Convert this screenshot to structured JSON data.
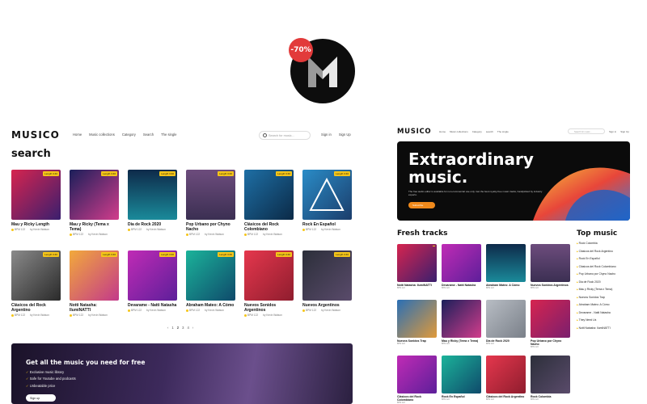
{
  "badge": {
    "discount": "-70%",
    "logo": "M"
  },
  "left": {
    "brand": "MUSICO",
    "nav": [
      "Home",
      "Music collections",
      "Category",
      "Search",
      "The single"
    ],
    "search_placeholder": "Search for music...",
    "auth": [
      "Sign in",
      "Sign Up"
    ],
    "page_title": "search",
    "cards": [
      {
        "title": "Mau y Ricky Length",
        "meta": "BPM 122",
        "by": "by Kevin Watson",
        "tag": "Length 3:40"
      },
      {
        "title": "Mau y Ricky (Tema x Tema)",
        "meta": "BPM 122",
        "by": "by Kevin Watson",
        "tag": "Length 3:40"
      },
      {
        "title": "Dia de Rock 2020",
        "meta": "BPM 122",
        "by": "by Kevin Watson",
        "tag": "Length 3:40"
      },
      {
        "title": "Pop Urbano por Chyno Nacho",
        "meta": "BPM 122",
        "by": "by Kevin Watson",
        "tag": "Length 3:40"
      },
      {
        "title": "Clásicos del Rock Colombiano",
        "meta": "BPM 122",
        "by": "by Kevin Watson",
        "tag": "Length 3:40"
      },
      {
        "title": "Rock En Español",
        "meta": "BPM 122",
        "by": "by Kevin Watson",
        "tag": "Length 3:40"
      },
      {
        "title": "Clásicos del Rock Argentino",
        "meta": "BPM 122",
        "by": "by Kevin Watson",
        "tag": "Length 3:40"
      },
      {
        "title": "Notti Natasha: IlumiNATTI",
        "meta": "BPM 122",
        "by": "by Kevin Watson",
        "tag": "Length 3:40"
      },
      {
        "title": "Devarame - Natti Natasha",
        "meta": "BPM 122",
        "by": "by Kevin Watson",
        "tag": "Length 3:40"
      },
      {
        "title": "Abraham Mateo: A Cómo",
        "meta": "BPM 122",
        "by": "by Kevin Watson",
        "tag": "Length 3:40"
      },
      {
        "title": "Nuevos Sonidos Argentinos",
        "meta": "BPM 122",
        "by": "by Kevin Watson",
        "tag": "Length 3:40"
      },
      {
        "title": "Nuevos Argentinos",
        "meta": "BPM 122",
        "by": "by Kevin Watson",
        "tag": "Length 3:40"
      }
    ],
    "pager": [
      "‹",
      "1",
      "2",
      "3",
      "4",
      "›"
    ],
    "banner": {
      "headline": "Get all the music you need for free",
      "features": [
        "Exclusive music library",
        "Safe for Youtube and podcasts",
        "Unbeatable price"
      ],
      "button": "Sign up"
    }
  },
  "right": {
    "brand": "MUSICO",
    "nav": [
      "Home",
      "Music collections",
      "Category",
      "search",
      "The single"
    ],
    "search_placeholder": "Search for music...",
    "auth": [
      "Sign in",
      "Sign Up"
    ],
    "hero_title_1": "Extraordinary",
    "hero_title_2": "music.",
    "hero_sub": "The free audio editor is available for non-commercial use only. Get the best royalty-free music tracks, handpicked by industry experts.",
    "hero_button": "Subscribe",
    "fresh_title": "Fresh tracks",
    "top_title": "Top music",
    "fresh": [
      {
        "title": "Notti Natasha: IlumiNATTI",
        "meta": "BPM 122"
      },
      {
        "title": "Devarame - Natti Natasha",
        "meta": "BPM 122"
      },
      {
        "title": "Abraham Mateo: A Cómo",
        "meta": "BPM 122"
      },
      {
        "title": "Nuevos Sonidos Argentinos",
        "meta": "BPM 122"
      },
      {
        "title": "Nuevos Sonidos Trap",
        "meta": "BPM 122"
      },
      {
        "title": "Mau y Ricky (Tema x Tema)",
        "meta": "BPM 122"
      },
      {
        "title": "Dia de Rock 2020",
        "meta": "BPM 122"
      },
      {
        "title": "Pop Urbano por Chyno Nacho",
        "meta": "BPM 122"
      },
      {
        "title": "Clásicos del Rock Colombiano",
        "meta": "BPM 122"
      },
      {
        "title": "Rock En Español",
        "meta": "BPM 122"
      },
      {
        "title": "Clásicos del Rock Argentino",
        "meta": "BPM 122"
      },
      {
        "title": "Rock Colombia",
        "meta": "BPM 122"
      }
    ],
    "top": [
      "Rock Colombia",
      "Clásicos del Rock Argentino",
      "Rock En Español",
      "Clásicos del Rock Colombiano",
      "Pop Urbano por Chyno Nacho",
      "Dia de Rock 2020",
      "Mau y Ricky (Tema x Tema)",
      "Nuevos Sonidos Trap",
      "Abraham Mateo: A Cómo",
      "Devarame - Natti Natasha",
      "They Need Us",
      "Notti Natasha: IlumiNATTI"
    ]
  }
}
